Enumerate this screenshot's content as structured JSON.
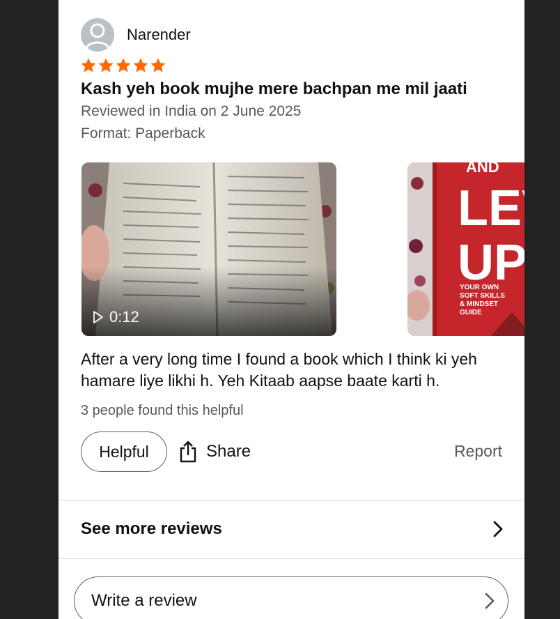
{
  "review": {
    "reviewer_name": "Narender",
    "rating": 5,
    "max_rating": 5,
    "star_color": "#ff6a00",
    "title": "Kash yeh book mujhe mere bachpan me mil jaati",
    "date_line": "Reviewed in India on 2 June 2025",
    "format_line": "Format: Paperback",
    "media": [
      {
        "type": "video",
        "duration": "0:12",
        "icon": "play-icon"
      },
      {
        "type": "photo",
        "cover_words": [
          "AND",
          "LEV",
          "UP"
        ],
        "cover_tagline": [
          "YOUR OWN",
          "SOFT SKILLS",
          "& MINDSET",
          "GUIDE"
        ]
      }
    ],
    "body": "After a very long time I found a book which I think ki yeh hamare liye likhi h. Yeh Kitaab aapse baate karti h.",
    "helpful_count_text": "3 people found this helpful"
  },
  "actions": {
    "helpful_label": "Helpful",
    "share_label": "Share",
    "share_icon": "share-icon",
    "report_label": "Report"
  },
  "footer": {
    "see_more_label": "See more reviews",
    "write_review_label": "Write a review",
    "chevron_icon": "chevron-right-icon"
  }
}
